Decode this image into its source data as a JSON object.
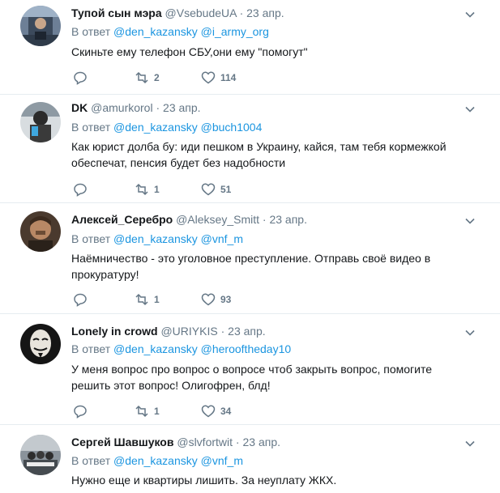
{
  "reply_prefix": "В ответ",
  "icons": {
    "reply": "reply-icon",
    "retweet": "retweet-icon",
    "like": "heart-icon",
    "more": "chevron-down-icon"
  },
  "colors": {
    "text": "#14171a",
    "secondary": "#657786",
    "link": "#1b95e0",
    "divider": "#e6ecf0"
  },
  "tweets": [
    {
      "name": "Тупой сын мэра",
      "handle": "@VsebudeUA",
      "time": "23 апр.",
      "mentions": [
        "@den_kazansky",
        "@i_army_org"
      ],
      "text": "Скиньте ему телефон СБУ,они ему \"помогут\"",
      "retweets": "2",
      "likes": "114"
    },
    {
      "name": "DK",
      "handle": "@amurkorol",
      "time": "23 апр.",
      "mentions": [
        "@den_kazansky",
        "@buch1004"
      ],
      "text": "Как юрист долба  бу: иди пешком в Украину, кайся, там тебя кормежкой обеспечат, пенсия будет без надобности",
      "retweets": "1",
      "likes": "51"
    },
    {
      "name": "Алексей_Серебро",
      "handle": "@Aleksey_Smitt",
      "time": "23 апр.",
      "mentions": [
        "@den_kazansky",
        "@vnf_m"
      ],
      "text": "Наёмничество - это уголовное преступление. Отправь своё видео в прокуратуру!",
      "retweets": "1",
      "likes": "93"
    },
    {
      "name": "Lonely in crowd",
      "handle": "@URIYKIS",
      "time": "23 апр.",
      "mentions": [
        "@den_kazansky",
        "@herooftheday10"
      ],
      "text": "У меня вопрос про вопрос о вопросе чтоб закрыть вопрос,  помогите решить этот вопрос! Олигофрен, блд!",
      "retweets": "1",
      "likes": "34"
    },
    {
      "name": "Сергей Шавшуков",
      "handle": "@slvfortwit",
      "time": "23 апр.",
      "mentions": [
        "@den_kazansky",
        "@vnf_m"
      ],
      "text": "Нужно еще и квартиры лишить. За неуплату ЖКХ."
    }
  ]
}
